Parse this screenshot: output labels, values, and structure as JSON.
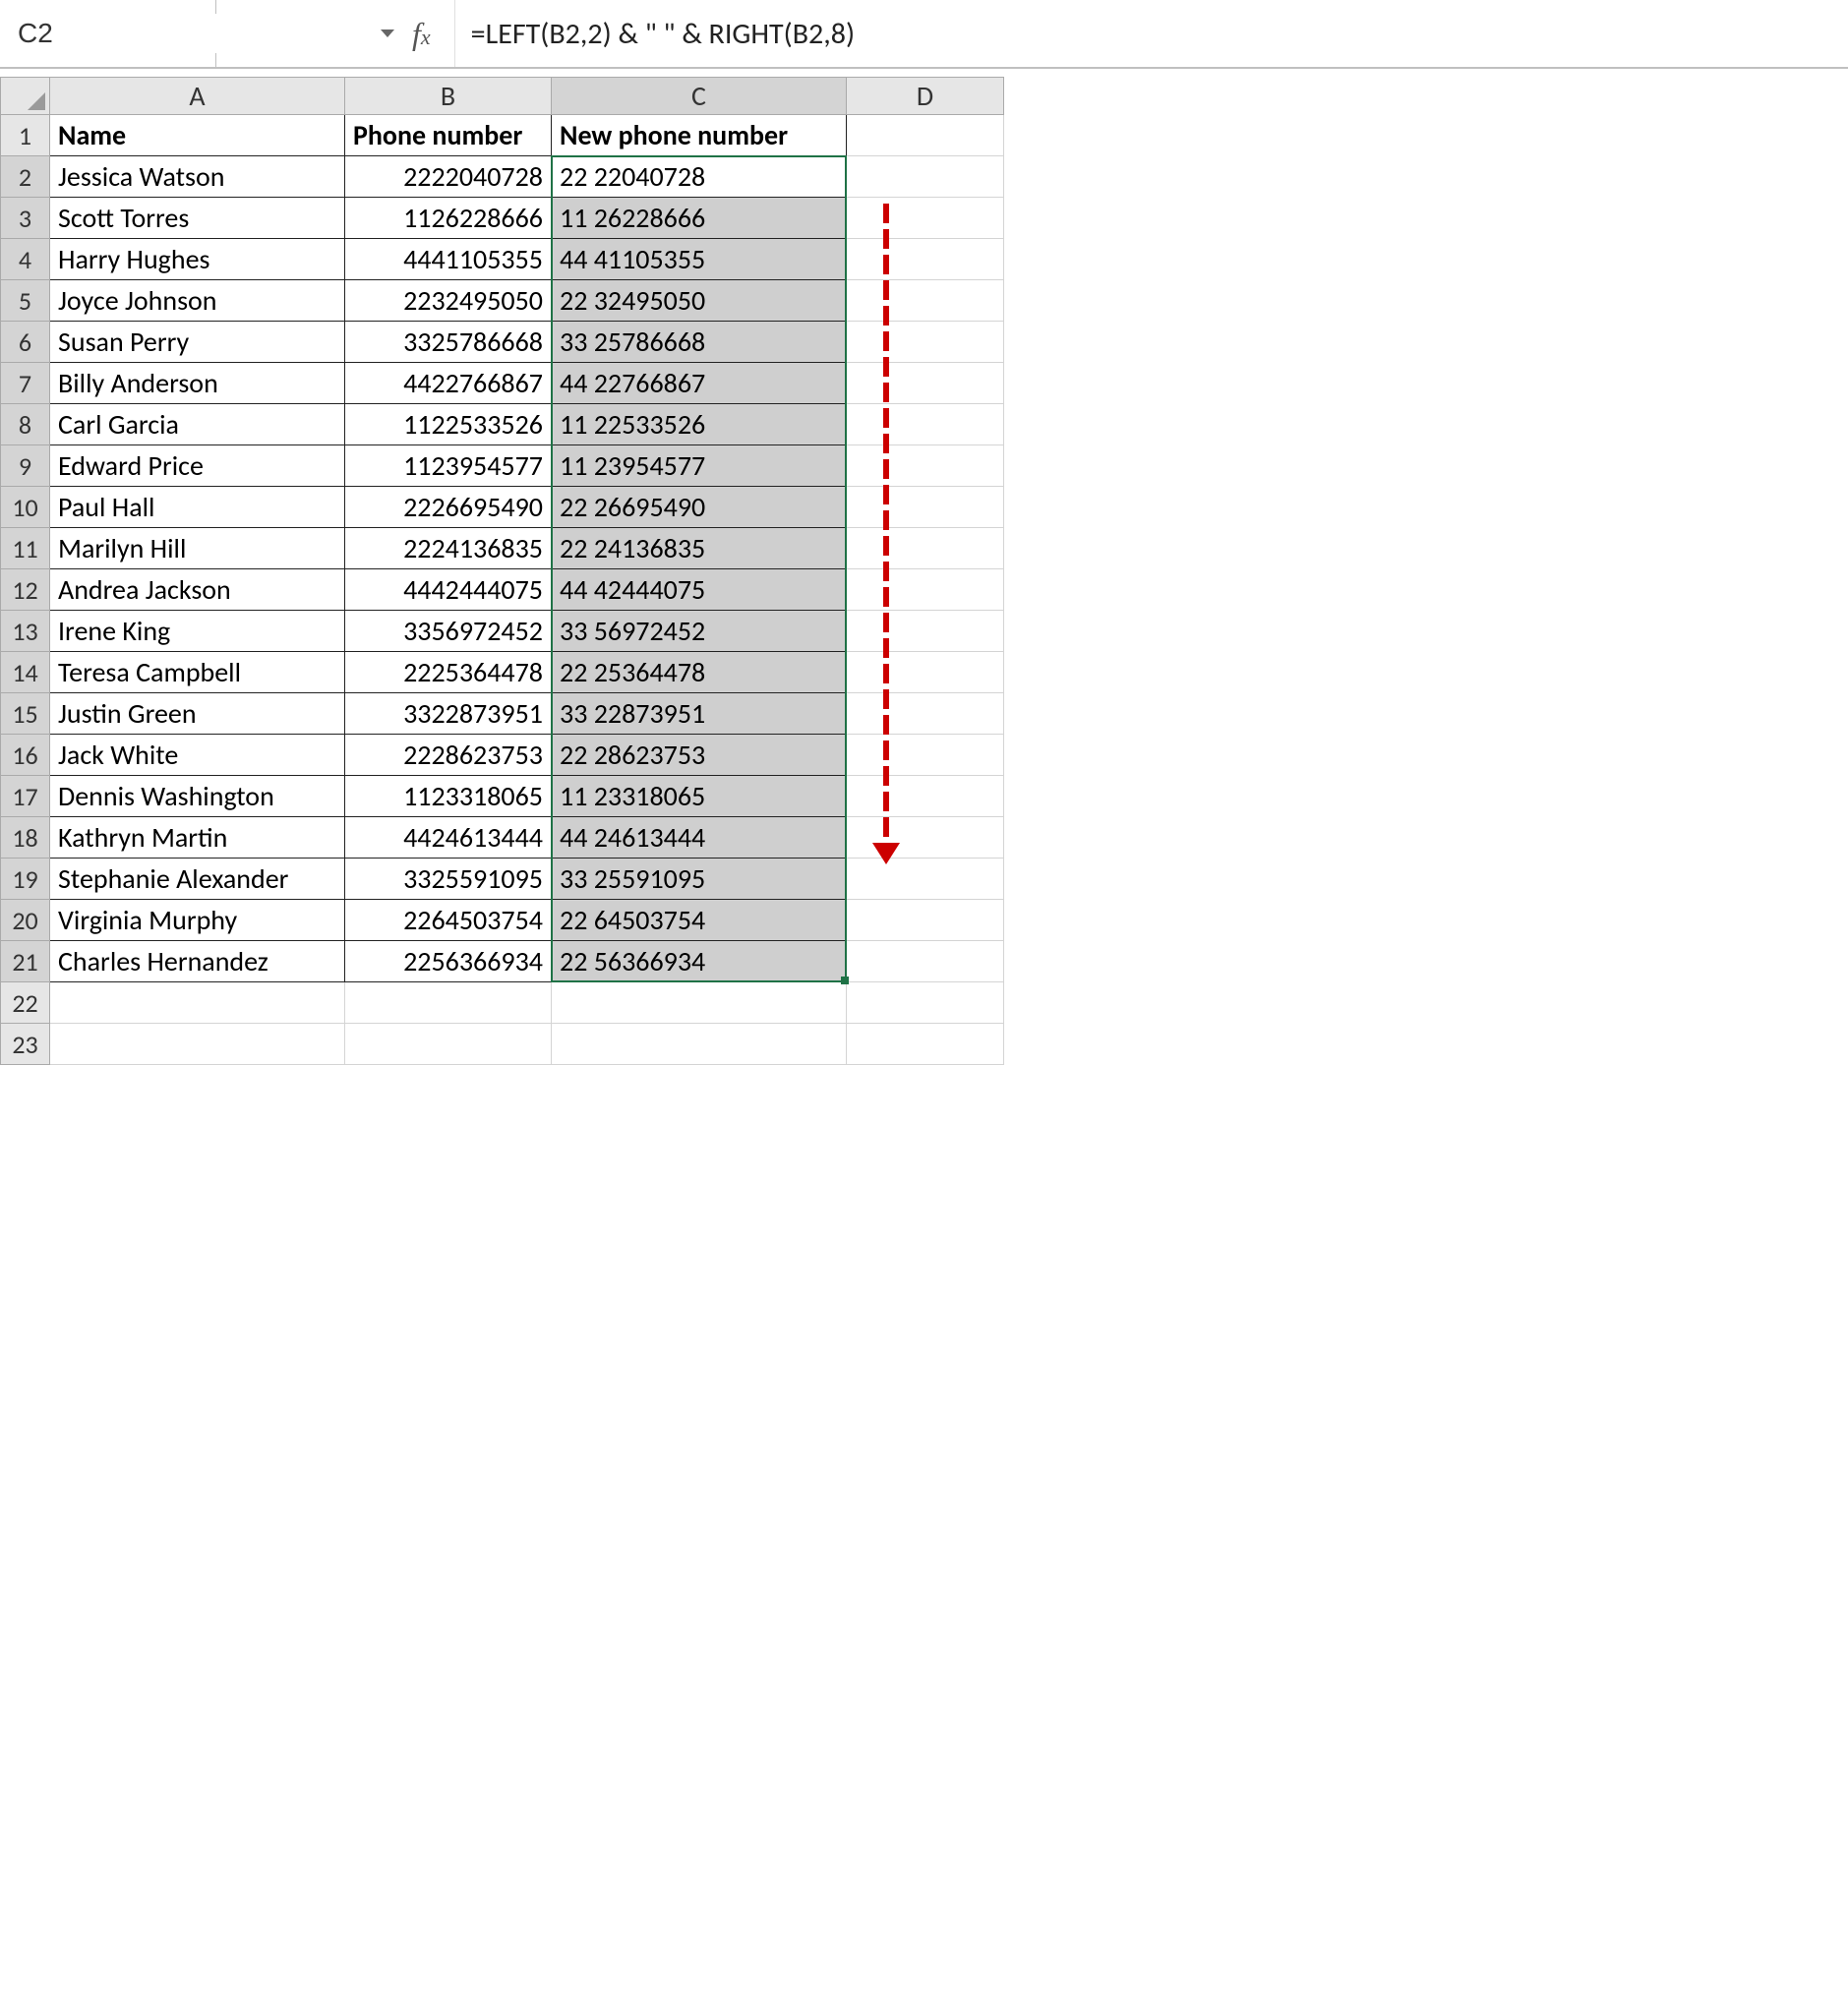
{
  "namebox": {
    "value": "C2"
  },
  "formula_bar": {
    "fx_label": "f",
    "fx_sub": "x",
    "formula": "=LEFT(B2,2) & \" \" & RIGHT(B2,8)"
  },
  "columns": [
    "A",
    "B",
    "C",
    "D"
  ],
  "header_row": {
    "A": "Name",
    "B": "Phone number",
    "C": "New phone number"
  },
  "selected_column": "C",
  "active_cell_row": 2,
  "selection_rows": [
    2,
    21
  ],
  "chart_data": {
    "type": "table",
    "columns": [
      "Name",
      "Phone number",
      "New phone number"
    ],
    "rows": [
      {
        "Name": "Jessica Watson",
        "Phone number": "2222040728",
        "New phone number": "22 22040728"
      },
      {
        "Name": "Scott Torres",
        "Phone number": "1126228666",
        "New phone number": "11 26228666"
      },
      {
        "Name": "Harry Hughes",
        "Phone number": "4441105355",
        "New phone number": "44 41105355"
      },
      {
        "Name": "Joyce Johnson",
        "Phone number": "2232495050",
        "New phone number": "22 32495050"
      },
      {
        "Name": "Susan Perry",
        "Phone number": "3325786668",
        "New phone number": "33 25786668"
      },
      {
        "Name": "Billy Anderson",
        "Phone number": "4422766867",
        "New phone number": "44 22766867"
      },
      {
        "Name": "Carl Garcia",
        "Phone number": "1122533526",
        "New phone number": "11 22533526"
      },
      {
        "Name": "Edward Price",
        "Phone number": "1123954577",
        "New phone number": "11 23954577"
      },
      {
        "Name": "Paul Hall",
        "Phone number": "2226695490",
        "New phone number": "22 26695490"
      },
      {
        "Name": "Marilyn Hill",
        "Phone number": "2224136835",
        "New phone number": "22 24136835"
      },
      {
        "Name": "Andrea Jackson",
        "Phone number": "4442444075",
        "New phone number": "44 42444075"
      },
      {
        "Name": "Irene King",
        "Phone number": "3356972452",
        "New phone number": "33 56972452"
      },
      {
        "Name": "Teresa Campbell",
        "Phone number": "2225364478",
        "New phone number": "22 25364478"
      },
      {
        "Name": "Justin Green",
        "Phone number": "3322873951",
        "New phone number": "33 22873951"
      },
      {
        "Name": "Jack White",
        "Phone number": "2228623753",
        "New phone number": "22 28623753"
      },
      {
        "Name": "Dennis Washington",
        "Phone number": "1123318065",
        "New phone number": "11 23318065"
      },
      {
        "Name": "Kathryn Martin",
        "Phone number": "4424613444",
        "New phone number": "44 24613444"
      },
      {
        "Name": "Stephanie Alexander",
        "Phone number": "3325591095",
        "New phone number": "33 25591095"
      },
      {
        "Name": "Virginia Murphy",
        "Phone number": "2264503754",
        "New phone number": "22 64503754"
      },
      {
        "Name": "Charles Hernandez",
        "Phone number": "2256366934",
        "New phone number": "22 56366934"
      }
    ]
  },
  "empty_rows": [
    22,
    23
  ]
}
